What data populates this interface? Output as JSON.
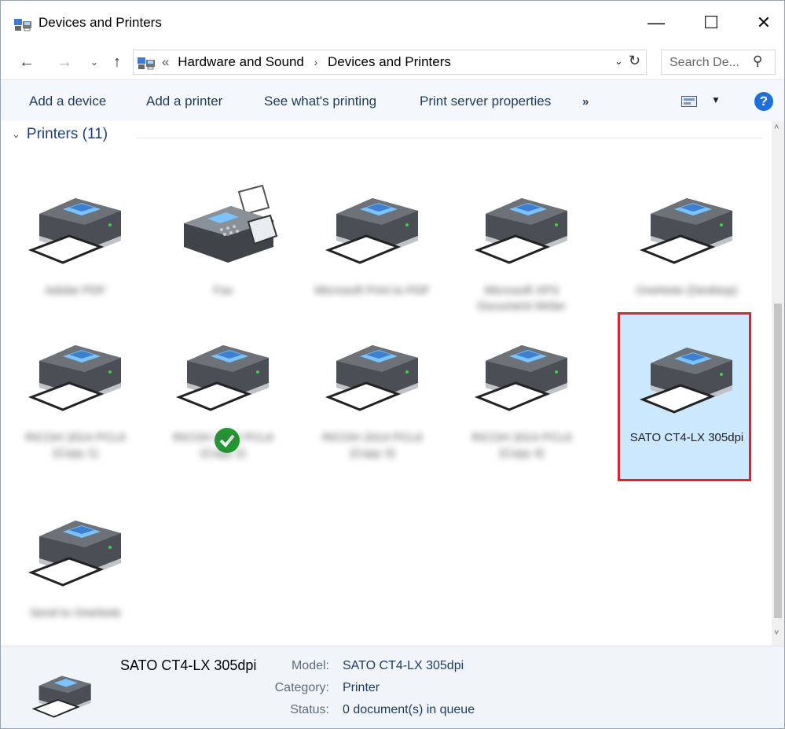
{
  "window": {
    "title": "Devices and Printers",
    "controls": {
      "minimize": "—",
      "maximize": "☐",
      "close": "✕"
    }
  },
  "addressbar": {
    "back": "←",
    "forward": "→",
    "recent": "⌄",
    "up": "↑",
    "overflow": "«",
    "crumbs": [
      "Hardware and Sound",
      "Devices and Printers"
    ],
    "crumb_separator": "›",
    "dropdown": "⌄",
    "refresh": "↻",
    "search_placeholder": "Search De...",
    "search_icon": "⚲"
  },
  "commandbar": {
    "items": [
      "Add a device",
      "Add a printer",
      "See what's printing",
      "Print server properties"
    ],
    "more": "»",
    "view_dropdown": "▼",
    "help": "?"
  },
  "group": {
    "label": "Printers (11)",
    "chevron": "⌄"
  },
  "printers": [
    {
      "label": "Adobe PDF",
      "icon": "printer-icon",
      "legible": false
    },
    {
      "label": "Fax",
      "icon": "fax-icon",
      "legible": false
    },
    {
      "label": "Microsoft Print to PDF",
      "icon": "printer-icon",
      "legible": false
    },
    {
      "label": "Microsoft XPS Document Writer",
      "icon": "printer-icon",
      "legible": false
    },
    {
      "label": "OneNote (Desktop)",
      "icon": "printer-icon",
      "legible": false
    },
    {
      "label": "RICOH 2014 PCL6 (Copy 1)",
      "icon": "printer-icon",
      "legible": false
    },
    {
      "label": "RICOH 2014 PCL6 (Copy 2)",
      "icon": "printer-icon",
      "legible": false,
      "default": true
    },
    {
      "label": "RICOH 2014 PCL6 (Copy 3)",
      "icon": "printer-icon",
      "legible": false
    },
    {
      "label": "RICOH 2014 PCL6 (Copy 4)",
      "icon": "printer-icon",
      "legible": false
    },
    {
      "label": "SATO CT4-LX 305dpi",
      "icon": "printer-icon",
      "legible": true,
      "selected": true
    },
    {
      "label": "Send to OneNote",
      "icon": "printer-icon",
      "legible": false
    }
  ],
  "scrollbar": {
    "up": "˄",
    "down": "˅"
  },
  "details": {
    "name": "SATO CT4-LX 305dpi",
    "model_label": "Model:",
    "model": "SATO CT4-LX 305dpi",
    "category_label": "Category:",
    "category": "Printer",
    "status_label": "Status:",
    "status": "0 document(s) in queue"
  },
  "colors": {
    "selection_bg": "#cce8ff",
    "highlight_border": "#e0202b",
    "link_text": "#1e395b",
    "accent": "#1e6fd9"
  }
}
